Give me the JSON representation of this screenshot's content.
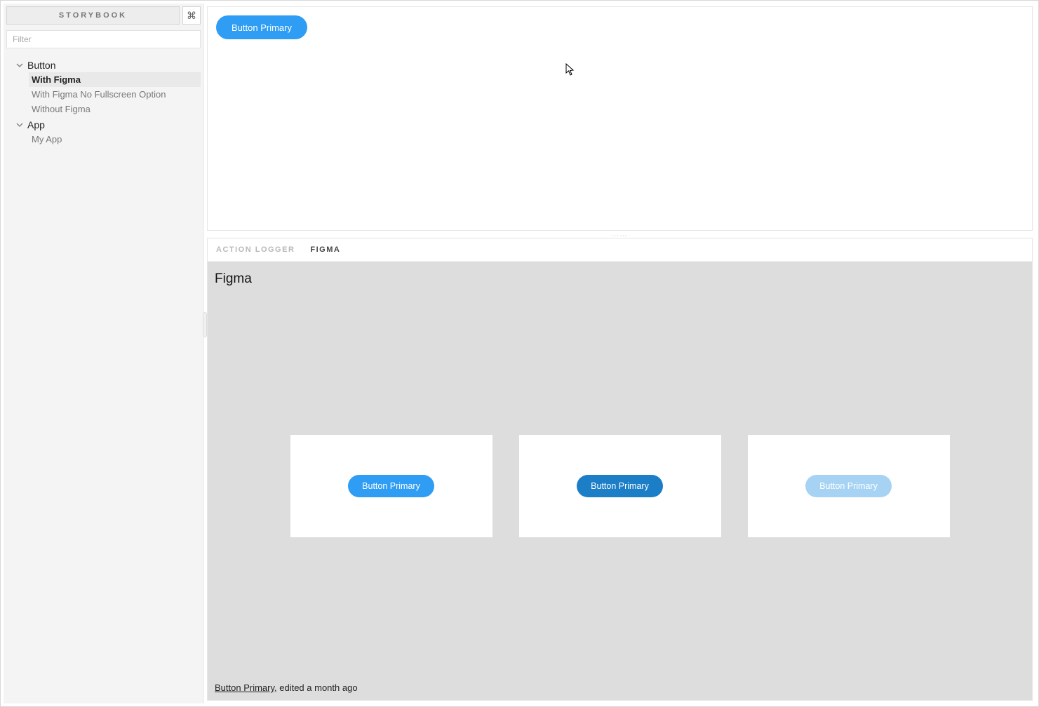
{
  "sidebar": {
    "title": "STORYBOOK",
    "shortcut_symbol": "⌘",
    "filter_placeholder": "Filter",
    "groups": [
      {
        "label": "Button",
        "items": [
          {
            "label": "With Figma",
            "active": true
          },
          {
            "label": "With Figma No Fullscreen Option",
            "active": false
          },
          {
            "label": "Without Figma",
            "active": false
          }
        ]
      },
      {
        "label": "App",
        "items": [
          {
            "label": "My App",
            "active": false
          }
        ]
      }
    ]
  },
  "preview": {
    "button_label": "Button Primary"
  },
  "panel": {
    "tabs": [
      {
        "label": "ACTION LOGGER",
        "active": false
      },
      {
        "label": "FIGMA",
        "active": true
      }
    ],
    "figma": {
      "title": "Figma",
      "artboards": [
        {
          "label": "Button Primary",
          "variant": "normal"
        },
        {
          "label": "Button Primary",
          "variant": "dark"
        },
        {
          "label": "Button Primary",
          "variant": "light"
        }
      ],
      "footer_doc": "Button Primary",
      "footer_suffix": ", edited a month ago"
    }
  }
}
